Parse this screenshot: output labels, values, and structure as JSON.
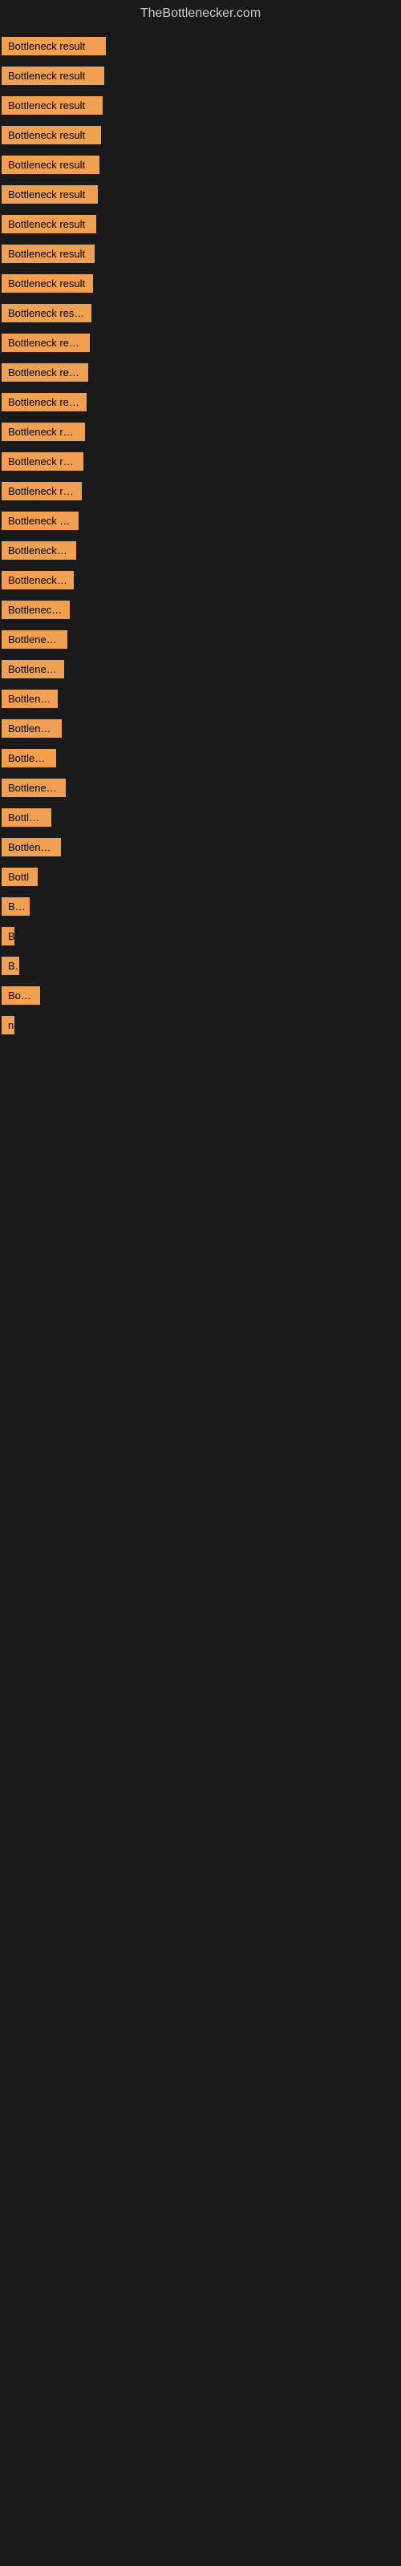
{
  "site_title": "TheBottlenecker.com",
  "items": [
    {
      "label": "Bottleneck result",
      "width": 130
    },
    {
      "label": "Bottleneck result",
      "width": 128
    },
    {
      "label": "Bottleneck result",
      "width": 126
    },
    {
      "label": "Bottleneck result",
      "width": 124
    },
    {
      "label": "Bottleneck result",
      "width": 122
    },
    {
      "label": "Bottleneck result",
      "width": 120
    },
    {
      "label": "Bottleneck result",
      "width": 118
    },
    {
      "label": "Bottleneck result",
      "width": 116
    },
    {
      "label": "Bottleneck result",
      "width": 114
    },
    {
      "label": "Bottleneck result",
      "width": 112
    },
    {
      "label": "Bottleneck result",
      "width": 110
    },
    {
      "label": "Bottleneck result",
      "width": 108
    },
    {
      "label": "Bottleneck result",
      "width": 106
    },
    {
      "label": "Bottleneck result",
      "width": 104
    },
    {
      "label": "Bottleneck result",
      "width": 102
    },
    {
      "label": "Bottleneck result",
      "width": 100
    },
    {
      "label": "Bottleneck result",
      "width": 96
    },
    {
      "label": "Bottleneck result",
      "width": 93
    },
    {
      "label": "Bottleneck result",
      "width": 90
    },
    {
      "label": "Bottleneck res",
      "width": 85
    },
    {
      "label": "Bottleneck result",
      "width": 82
    },
    {
      "label": "Bottleneck re",
      "width": 78
    },
    {
      "label": "Bottleneck",
      "width": 70
    },
    {
      "label": "Bottleneck re",
      "width": 75
    },
    {
      "label": "Bottleneck r",
      "width": 68
    },
    {
      "label": "Bottleneck resu",
      "width": 80
    },
    {
      "label": "Bottlenec",
      "width": 62
    },
    {
      "label": "Bottleneck re",
      "width": 74
    },
    {
      "label": "Bottl",
      "width": 45
    },
    {
      "label": "Bot",
      "width": 35
    },
    {
      "label": "B",
      "width": 14
    },
    {
      "label": "Bo",
      "width": 22
    },
    {
      "label": "Bottle",
      "width": 48
    },
    {
      "label": "n",
      "width": 10
    }
  ]
}
